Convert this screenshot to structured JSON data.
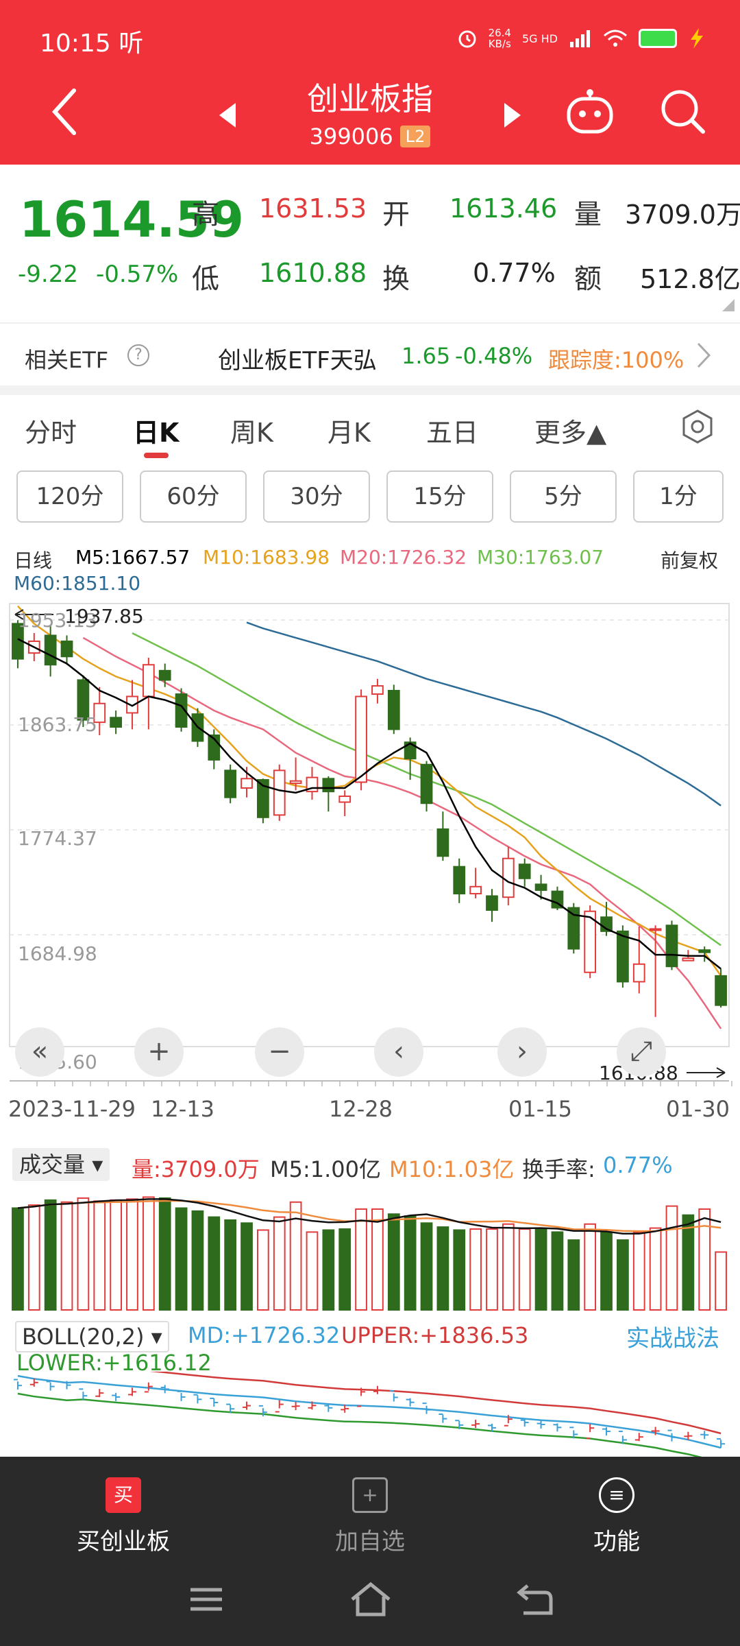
{
  "status": {
    "time": "10:15",
    "time_suffix": "听",
    "net_speed_value": "26.4",
    "net_speed_unit": "KB/s",
    "network": "5G HD"
  },
  "header": {
    "title": "创业板指",
    "code": "399006",
    "badge": "L2"
  },
  "quote": {
    "price": "1614.59",
    "change": "-9.22",
    "change_pct": "-0.57%",
    "high_label": "高",
    "high": "1631.53",
    "open_label": "开",
    "open": "1613.46",
    "volume_label": "量",
    "volume": "3709.0万",
    "low_label": "低",
    "low": "1610.88",
    "turnover_label": "换",
    "turnover": "0.77%",
    "amount_label": "额",
    "amount": "512.8亿"
  },
  "etf": {
    "label": "相关ETF",
    "help": "?",
    "name": "创业板ETF天弘",
    "price": "1.65",
    "pct": "-0.48%",
    "tracking": "跟踪度:100%"
  },
  "tabs": [
    "分时",
    "日K",
    "周K",
    "月K",
    "五日",
    "更多▲"
  ],
  "intervals": [
    "120分",
    "60分",
    "30分",
    "15分",
    "5分",
    "1分"
  ],
  "ma": {
    "type": "日线",
    "m5": "M5:1667.57",
    "m10": "M10:1683.98",
    "m20": "M20:1726.32",
    "m30": "M30:1763.07",
    "m60": "M60:1851.10",
    "adjust": "前复权",
    "colors": {
      "m5": "#000000",
      "m10": "#e6a21c",
      "m20": "#e9687d",
      "m30": "#6ec04d",
      "m60": "#2c6b96"
    }
  },
  "kchart": {
    "y_labels": [
      "1953.13",
      "1863.75",
      "1774.37",
      "1684.98",
      "1595.60"
    ],
    "max_label": "1937.85",
    "min_label": "1610.88",
    "x_labels": [
      "2023-11-29",
      "12-13",
      "12-28",
      "01-15",
      "01-30"
    ],
    "controls": [
      "«",
      "+",
      "−",
      "‹",
      "›",
      "⤢"
    ],
    "up_color": "#e23b3b",
    "down_color": "#2f6b1c"
  },
  "chart_data": {
    "type": "candlestick",
    "y_range": [
      1595.6,
      1953.13
    ],
    "candles": [
      [
        1950,
        1920,
        1953,
        1912
      ],
      [
        1925,
        1935,
        1942,
        1918
      ],
      [
        1940,
        1915,
        1948,
        1905
      ],
      [
        1935,
        1922,
        1940,
        1915
      ],
      [
        1902,
        1868,
        1906,
        1862
      ],
      [
        1866,
        1882,
        1896,
        1855
      ],
      [
        1870,
        1862,
        1876,
        1856
      ],
      [
        1874,
        1888,
        1902,
        1860
      ],
      [
        1888,
        1915,
        1921,
        1860
      ],
      [
        1910,
        1902,
        1916,
        1896
      ],
      [
        1890,
        1862,
        1895,
        1858
      ],
      [
        1873,
        1850,
        1878,
        1845
      ],
      [
        1855,
        1834,
        1860,
        1826
      ],
      [
        1825,
        1802,
        1830,
        1797
      ],
      [
        1810,
        1818,
        1828,
        1802
      ],
      [
        1817,
        1785,
        1818,
        1780
      ],
      [
        1787,
        1825,
        1830,
        1782
      ],
      [
        1814,
        1816,
        1836,
        1808
      ],
      [
        1807,
        1819,
        1828,
        1800
      ],
      [
        1818,
        1807,
        1820,
        1790
      ],
      [
        1798,
        1803,
        1808,
        1786
      ],
      [
        1815,
        1888,
        1894,
        1808
      ],
      [
        1890,
        1897,
        1903,
        1882
      ],
      [
        1893,
        1860,
        1898,
        1856
      ],
      [
        1849,
        1835,
        1853,
        1817
      ],
      [
        1830,
        1797,
        1833,
        1790
      ],
      [
        1775,
        1752,
        1790,
        1748
      ],
      [
        1743,
        1720,
        1750,
        1712
      ],
      [
        1720,
        1726,
        1742,
        1716
      ],
      [
        1718,
        1706,
        1724,
        1696
      ],
      [
        1717,
        1750,
        1760,
        1710
      ],
      [
        1745,
        1733,
        1750,
        1726
      ],
      [
        1728,
        1723,
        1736,
        1715
      ],
      [
        1722,
        1708,
        1726,
        1706
      ],
      [
        1708,
        1673,
        1712,
        1669
      ],
      [
        1653,
        1705,
        1710,
        1648
      ],
      [
        1700,
        1688,
        1713,
        1684
      ],
      [
        1688,
        1645,
        1693,
        1640
      ],
      [
        1645,
        1660,
        1692,
        1635
      ],
      [
        1690,
        1690,
        1693,
        1615
      ],
      [
        1693,
        1658,
        1697,
        1655
      ],
      [
        1663,
        1665,
        1672,
        1663
      ],
      [
        1672,
        1670,
        1675,
        1662
      ],
      [
        1650,
        1625,
        1656,
        1623
      ]
    ],
    "ma5": [
      1937,
      1930,
      1923,
      1916,
      1905,
      1893,
      1887,
      1880,
      1888,
      1885,
      1880,
      1862,
      1852,
      1836,
      1823,
      1812,
      1808,
      1806,
      1810,
      1810,
      1810,
      1820,
      1831,
      1840,
      1848,
      1840,
      1815,
      1786,
      1760,
      1740,
      1730,
      1725,
      1717,
      1712,
      1702,
      1700,
      1690,
      1684,
      1680,
      1668,
      1668,
      1667,
      1667,
      1656
    ],
    "ma10": [
      1965,
      1950,
      1940,
      1930,
      1920,
      1912,
      1905,
      1900,
      1895,
      1890,
      1884,
      1876,
      1862,
      1848,
      1833,
      1822,
      1816,
      1812,
      1810,
      1810,
      1812,
      1822,
      1830,
      1836,
      1834,
      1828,
      1818,
      1806,
      1794,
      1786,
      1778,
      1768,
      1752,
      1740,
      1727,
      1716,
      1708,
      1700,
      1694,
      1686,
      1680,
      1675,
      1670,
      1650
    ],
    "ma20_start": 4,
    "ma20": [
      1938,
      1930,
      1922,
      1915,
      1908,
      1900,
      1892,
      1884,
      1876,
      1870,
      1865,
      1860,
      1850,
      1840,
      1833,
      1826,
      1820,
      1818,
      1815,
      1811,
      1806,
      1800,
      1793,
      1786,
      1777,
      1768,
      1760,
      1752,
      1745,
      1740,
      1735,
      1728,
      1716,
      1705,
      1693,
      1680,
      1662,
      1646,
      1626,
      1605
    ],
    "ma30_start": 7,
    "ma30": [
      1942,
      1935,
      1928,
      1921,
      1914,
      1906,
      1898,
      1890,
      1882,
      1874,
      1866,
      1859,
      1852,
      1846,
      1840,
      1834,
      1828,
      1822,
      1817,
      1812,
      1807,
      1802,
      1796,
      1788,
      1780,
      1772,
      1764,
      1756,
      1748,
      1740,
      1732,
      1724,
      1715,
      1706,
      1696,
      1686,
      1676
    ],
    "ma60_start": 14,
    "ma60": [
      1951,
      1946,
      1942,
      1938,
      1934,
      1930,
      1926,
      1922,
      1918,
      1913,
      1908,
      1903,
      1899,
      1895,
      1891,
      1887,
      1883,
      1879,
      1875,
      1870,
      1864,
      1858,
      1852,
      1845,
      1838,
      1830,
      1822,
      1814,
      1805,
      1795
    ],
    "volume_range": [
      0,
      1.25
    ],
    "volume": [
      1.02,
      1.05,
      1.1,
      1.08,
      1.12,
      1.09,
      1.1,
      1.11,
      1.13,
      1.12,
      1.02,
      0.99,
      0.93,
      0.9,
      0.87,
      0.8,
      0.93,
      1.08,
      0.78,
      0.8,
      0.81,
      1.01,
      1.01,
      0.96,
      0.94,
      0.87,
      0.83,
      0.8,
      0.81,
      0.81,
      0.86,
      0.81,
      0.81,
      0.78,
      0.7,
      0.86,
      0.78,
      0.7,
      0.78,
      0.82,
      1.04,
      0.95,
      1.01,
      0.58
    ],
    "vol_up": [
      false,
      true,
      false,
      true,
      true,
      true,
      true,
      true,
      true,
      false,
      false,
      false,
      false,
      false,
      false,
      true,
      true,
      true,
      true,
      false,
      false,
      true,
      true,
      false,
      false,
      false,
      false,
      false,
      true,
      true,
      true,
      true,
      false,
      false,
      false,
      true,
      false,
      false,
      true,
      true,
      true,
      false,
      true,
      true
    ]
  },
  "volume": {
    "selector": "成交量",
    "vol": "量:3709.0万",
    "m5": "M5:1.00亿",
    "m10": "M10:1.03亿",
    "turnover_label": "换手率:",
    "turnover_value": "0.77%"
  },
  "boll": {
    "selector": "BOLL(20,2)",
    "md": "MD:+1726.32",
    "upper": "UPPER:+1836.53",
    "lower": "LOWER:+1616.12",
    "strategy": "实战战法"
  },
  "bottom": {
    "buy": "买创业板",
    "buy_icon": "买",
    "add": "加自选",
    "func": "功能"
  }
}
